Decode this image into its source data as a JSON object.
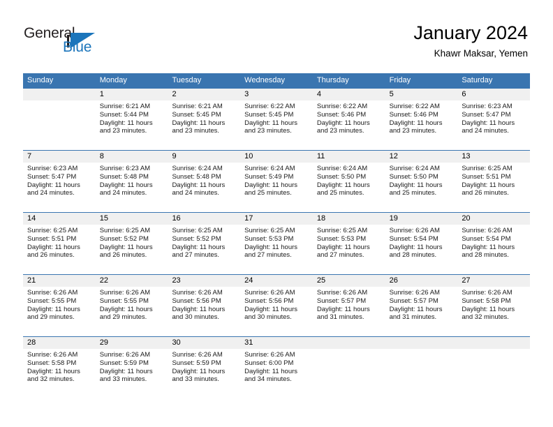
{
  "brand": {
    "name_part1": "General",
    "name_part2": "Blue",
    "accent_color": "#1b75bb"
  },
  "header": {
    "title": "January 2024",
    "subtitle": "Khawr Maksar, Yemen"
  },
  "theme": {
    "header_row_bg": "#3a75b0",
    "day_number_bg": "#f0f0f0",
    "grid_line": "#3a75b0"
  },
  "weekdays": [
    "Sunday",
    "Monday",
    "Tuesday",
    "Wednesday",
    "Thursday",
    "Friday",
    "Saturday"
  ],
  "weeks": [
    [
      {
        "day": "",
        "sunrise": "",
        "sunset": "",
        "daylight_line1": "",
        "daylight_line2": ""
      },
      {
        "day": "1",
        "sunrise": "Sunrise: 6:21 AM",
        "sunset": "Sunset: 5:44 PM",
        "daylight_line1": "Daylight: 11 hours",
        "daylight_line2": "and 23 minutes."
      },
      {
        "day": "2",
        "sunrise": "Sunrise: 6:21 AM",
        "sunset": "Sunset: 5:45 PM",
        "daylight_line1": "Daylight: 11 hours",
        "daylight_line2": "and 23 minutes."
      },
      {
        "day": "3",
        "sunrise": "Sunrise: 6:22 AM",
        "sunset": "Sunset: 5:45 PM",
        "daylight_line1": "Daylight: 11 hours",
        "daylight_line2": "and 23 minutes."
      },
      {
        "day": "4",
        "sunrise": "Sunrise: 6:22 AM",
        "sunset": "Sunset: 5:46 PM",
        "daylight_line1": "Daylight: 11 hours",
        "daylight_line2": "and 23 minutes."
      },
      {
        "day": "5",
        "sunrise": "Sunrise: 6:22 AM",
        "sunset": "Sunset: 5:46 PM",
        "daylight_line1": "Daylight: 11 hours",
        "daylight_line2": "and 23 minutes."
      },
      {
        "day": "6",
        "sunrise": "Sunrise: 6:23 AM",
        "sunset": "Sunset: 5:47 PM",
        "daylight_line1": "Daylight: 11 hours",
        "daylight_line2": "and 24 minutes."
      }
    ],
    [
      {
        "day": "7",
        "sunrise": "Sunrise: 6:23 AM",
        "sunset": "Sunset: 5:47 PM",
        "daylight_line1": "Daylight: 11 hours",
        "daylight_line2": "and 24 minutes."
      },
      {
        "day": "8",
        "sunrise": "Sunrise: 6:23 AM",
        "sunset": "Sunset: 5:48 PM",
        "daylight_line1": "Daylight: 11 hours",
        "daylight_line2": "and 24 minutes."
      },
      {
        "day": "9",
        "sunrise": "Sunrise: 6:24 AM",
        "sunset": "Sunset: 5:48 PM",
        "daylight_line1": "Daylight: 11 hours",
        "daylight_line2": "and 24 minutes."
      },
      {
        "day": "10",
        "sunrise": "Sunrise: 6:24 AM",
        "sunset": "Sunset: 5:49 PM",
        "daylight_line1": "Daylight: 11 hours",
        "daylight_line2": "and 25 minutes."
      },
      {
        "day": "11",
        "sunrise": "Sunrise: 6:24 AM",
        "sunset": "Sunset: 5:50 PM",
        "daylight_line1": "Daylight: 11 hours",
        "daylight_line2": "and 25 minutes."
      },
      {
        "day": "12",
        "sunrise": "Sunrise: 6:24 AM",
        "sunset": "Sunset: 5:50 PM",
        "daylight_line1": "Daylight: 11 hours",
        "daylight_line2": "and 25 minutes."
      },
      {
        "day": "13",
        "sunrise": "Sunrise: 6:25 AM",
        "sunset": "Sunset: 5:51 PM",
        "daylight_line1": "Daylight: 11 hours",
        "daylight_line2": "and 26 minutes."
      }
    ],
    [
      {
        "day": "14",
        "sunrise": "Sunrise: 6:25 AM",
        "sunset": "Sunset: 5:51 PM",
        "daylight_line1": "Daylight: 11 hours",
        "daylight_line2": "and 26 minutes."
      },
      {
        "day": "15",
        "sunrise": "Sunrise: 6:25 AM",
        "sunset": "Sunset: 5:52 PM",
        "daylight_line1": "Daylight: 11 hours",
        "daylight_line2": "and 26 minutes."
      },
      {
        "day": "16",
        "sunrise": "Sunrise: 6:25 AM",
        "sunset": "Sunset: 5:52 PM",
        "daylight_line1": "Daylight: 11 hours",
        "daylight_line2": "and 27 minutes."
      },
      {
        "day": "17",
        "sunrise": "Sunrise: 6:25 AM",
        "sunset": "Sunset: 5:53 PM",
        "daylight_line1": "Daylight: 11 hours",
        "daylight_line2": "and 27 minutes."
      },
      {
        "day": "18",
        "sunrise": "Sunrise: 6:25 AM",
        "sunset": "Sunset: 5:53 PM",
        "daylight_line1": "Daylight: 11 hours",
        "daylight_line2": "and 27 minutes."
      },
      {
        "day": "19",
        "sunrise": "Sunrise: 6:26 AM",
        "sunset": "Sunset: 5:54 PM",
        "daylight_line1": "Daylight: 11 hours",
        "daylight_line2": "and 28 minutes."
      },
      {
        "day": "20",
        "sunrise": "Sunrise: 6:26 AM",
        "sunset": "Sunset: 5:54 PM",
        "daylight_line1": "Daylight: 11 hours",
        "daylight_line2": "and 28 minutes."
      }
    ],
    [
      {
        "day": "21",
        "sunrise": "Sunrise: 6:26 AM",
        "sunset": "Sunset: 5:55 PM",
        "daylight_line1": "Daylight: 11 hours",
        "daylight_line2": "and 29 minutes."
      },
      {
        "day": "22",
        "sunrise": "Sunrise: 6:26 AM",
        "sunset": "Sunset: 5:55 PM",
        "daylight_line1": "Daylight: 11 hours",
        "daylight_line2": "and 29 minutes."
      },
      {
        "day": "23",
        "sunrise": "Sunrise: 6:26 AM",
        "sunset": "Sunset: 5:56 PM",
        "daylight_line1": "Daylight: 11 hours",
        "daylight_line2": "and 30 minutes."
      },
      {
        "day": "24",
        "sunrise": "Sunrise: 6:26 AM",
        "sunset": "Sunset: 5:56 PM",
        "daylight_line1": "Daylight: 11 hours",
        "daylight_line2": "and 30 minutes."
      },
      {
        "day": "25",
        "sunrise": "Sunrise: 6:26 AM",
        "sunset": "Sunset: 5:57 PM",
        "daylight_line1": "Daylight: 11 hours",
        "daylight_line2": "and 31 minutes."
      },
      {
        "day": "26",
        "sunrise": "Sunrise: 6:26 AM",
        "sunset": "Sunset: 5:57 PM",
        "daylight_line1": "Daylight: 11 hours",
        "daylight_line2": "and 31 minutes."
      },
      {
        "day": "27",
        "sunrise": "Sunrise: 6:26 AM",
        "sunset": "Sunset: 5:58 PM",
        "daylight_line1": "Daylight: 11 hours",
        "daylight_line2": "and 32 minutes."
      }
    ],
    [
      {
        "day": "28",
        "sunrise": "Sunrise: 6:26 AM",
        "sunset": "Sunset: 5:58 PM",
        "daylight_line1": "Daylight: 11 hours",
        "daylight_line2": "and 32 minutes."
      },
      {
        "day": "29",
        "sunrise": "Sunrise: 6:26 AM",
        "sunset": "Sunset: 5:59 PM",
        "daylight_line1": "Daylight: 11 hours",
        "daylight_line2": "and 33 minutes."
      },
      {
        "day": "30",
        "sunrise": "Sunrise: 6:26 AM",
        "sunset": "Sunset: 5:59 PM",
        "daylight_line1": "Daylight: 11 hours",
        "daylight_line2": "and 33 minutes."
      },
      {
        "day": "31",
        "sunrise": "Sunrise: 6:26 AM",
        "sunset": "Sunset: 6:00 PM",
        "daylight_line1": "Daylight: 11 hours",
        "daylight_line2": "and 34 minutes."
      },
      {
        "day": "",
        "sunrise": "",
        "sunset": "",
        "daylight_line1": "",
        "daylight_line2": ""
      },
      {
        "day": "",
        "sunrise": "",
        "sunset": "",
        "daylight_line1": "",
        "daylight_line2": ""
      },
      {
        "day": "",
        "sunrise": "",
        "sunset": "",
        "daylight_line1": "",
        "daylight_line2": ""
      }
    ]
  ]
}
